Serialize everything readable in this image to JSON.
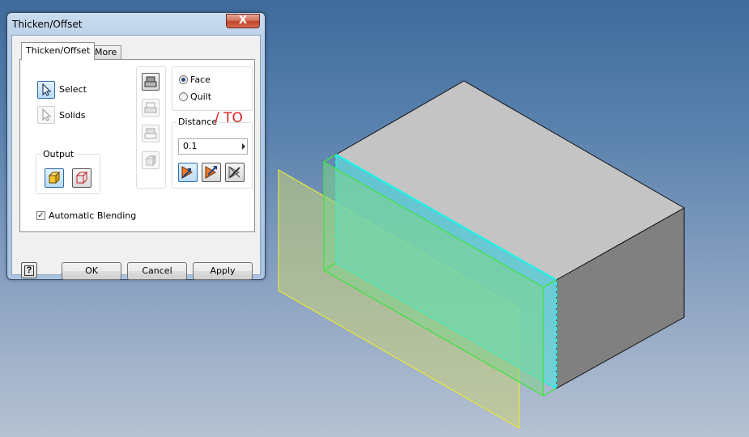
{
  "dialog": {
    "title": "Thicken/Offset",
    "close_label": "X",
    "tabs": [
      {
        "label": "Thicken/Offset",
        "active": true
      },
      {
        "label": "More",
        "active": false
      }
    ],
    "select_label": "Select",
    "solids_label": "Solids",
    "output_group_label": "Output",
    "face_label": "Face",
    "quilt_label": "Quilt",
    "selected_mode": "Face",
    "distance_label": "Distance",
    "distance_annotation": "/ TO",
    "distance_value": "0.1",
    "automatic_blending_label": "Automatic Blending",
    "automatic_blending_checked": true,
    "help_label": "?",
    "ok_label": "OK",
    "cancel_label": "Cancel",
    "apply_label": "Apply"
  },
  "colors": {
    "accent_blue": "#2e6ca8",
    "annotation_red": "#e02020",
    "highlight_cyan": "#1ef2e6",
    "preview_green": "#3fe23f",
    "offset_yellow": "#e6e63a",
    "block_top": "#c4c4c4",
    "block_right": "#808080"
  },
  "icons": [
    "select-cursor-icon",
    "solids-cursor-icon",
    "join-icon",
    "new-solid-icon",
    "cut-icon",
    "intersect-icon",
    "new-solid-surface-icon",
    "direction-flip-icon",
    "direction-symmetric-icon",
    "direction-disabled-icon",
    "help-icon"
  ]
}
